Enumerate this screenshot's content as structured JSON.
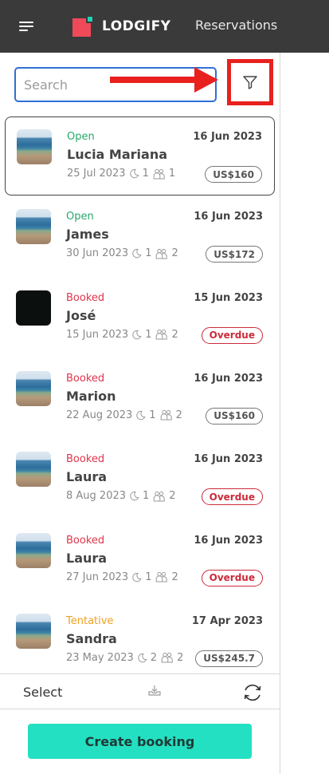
{
  "header": {
    "logo_text": "LODGIFY",
    "title": "Reservations"
  },
  "search": {
    "placeholder": "Search",
    "value": ""
  },
  "footer": {
    "select_label": "Select",
    "create_label": "Create booking"
  },
  "colors": {
    "topbar": "#3a3a3a",
    "accent": "#24e0c2",
    "brand_red": "#f04a59",
    "open": "#27a86a",
    "booked": "#e0344a",
    "tentative": "#f0a020",
    "annotation": "#e8211e"
  },
  "reservations": [
    {
      "status": "Open",
      "status_type": "open",
      "date": "16 Jun 2023",
      "guest": "Lucia Mariana",
      "checkin": "25 Jul 2023",
      "nights": "1",
      "guests": "1",
      "badge": "US$160",
      "badge_type": "amount",
      "thumb": "beach",
      "selected": true
    },
    {
      "status": "Open",
      "status_type": "open",
      "date": "16 Jun 2023",
      "guest": "James",
      "checkin": "30 Jun 2023",
      "nights": "1",
      "guests": "2",
      "badge": "US$172",
      "badge_type": "amount",
      "thumb": "beach",
      "selected": false
    },
    {
      "status": "Booked",
      "status_type": "booked",
      "date": "15 Jun 2023",
      "guest": "José",
      "checkin": "15 Jun 2023",
      "nights": "1",
      "guests": "2",
      "badge": "Overdue",
      "badge_type": "overdue",
      "thumb": "dark",
      "selected": false
    },
    {
      "status": "Booked",
      "status_type": "booked",
      "date": "16 Jun 2023",
      "guest": "Marion",
      "checkin": "22 Aug 2023",
      "nights": "1",
      "guests": "2",
      "badge": "US$160",
      "badge_type": "amount",
      "thumb": "beach",
      "selected": false
    },
    {
      "status": "Booked",
      "status_type": "booked",
      "date": "16 Jun 2023",
      "guest": "Laura",
      "checkin": "8 Aug 2023",
      "nights": "1",
      "guests": "2",
      "badge": "Overdue",
      "badge_type": "overdue",
      "thumb": "beach",
      "selected": false
    },
    {
      "status": "Booked",
      "status_type": "booked",
      "date": "16 Jun 2023",
      "guest": "Laura",
      "checkin": "27 Jun 2023",
      "nights": "1",
      "guests": "2",
      "badge": "Overdue",
      "badge_type": "overdue",
      "thumb": "beach",
      "selected": false
    },
    {
      "status": "Tentative",
      "status_type": "tentative",
      "date": "17 Apr 2023",
      "guest": "Sandra",
      "checkin": "23 May 2023",
      "nights": "2",
      "guests": "2",
      "badge": "US$245.7",
      "badge_type": "amount",
      "thumb": "beach",
      "selected": false
    }
  ]
}
